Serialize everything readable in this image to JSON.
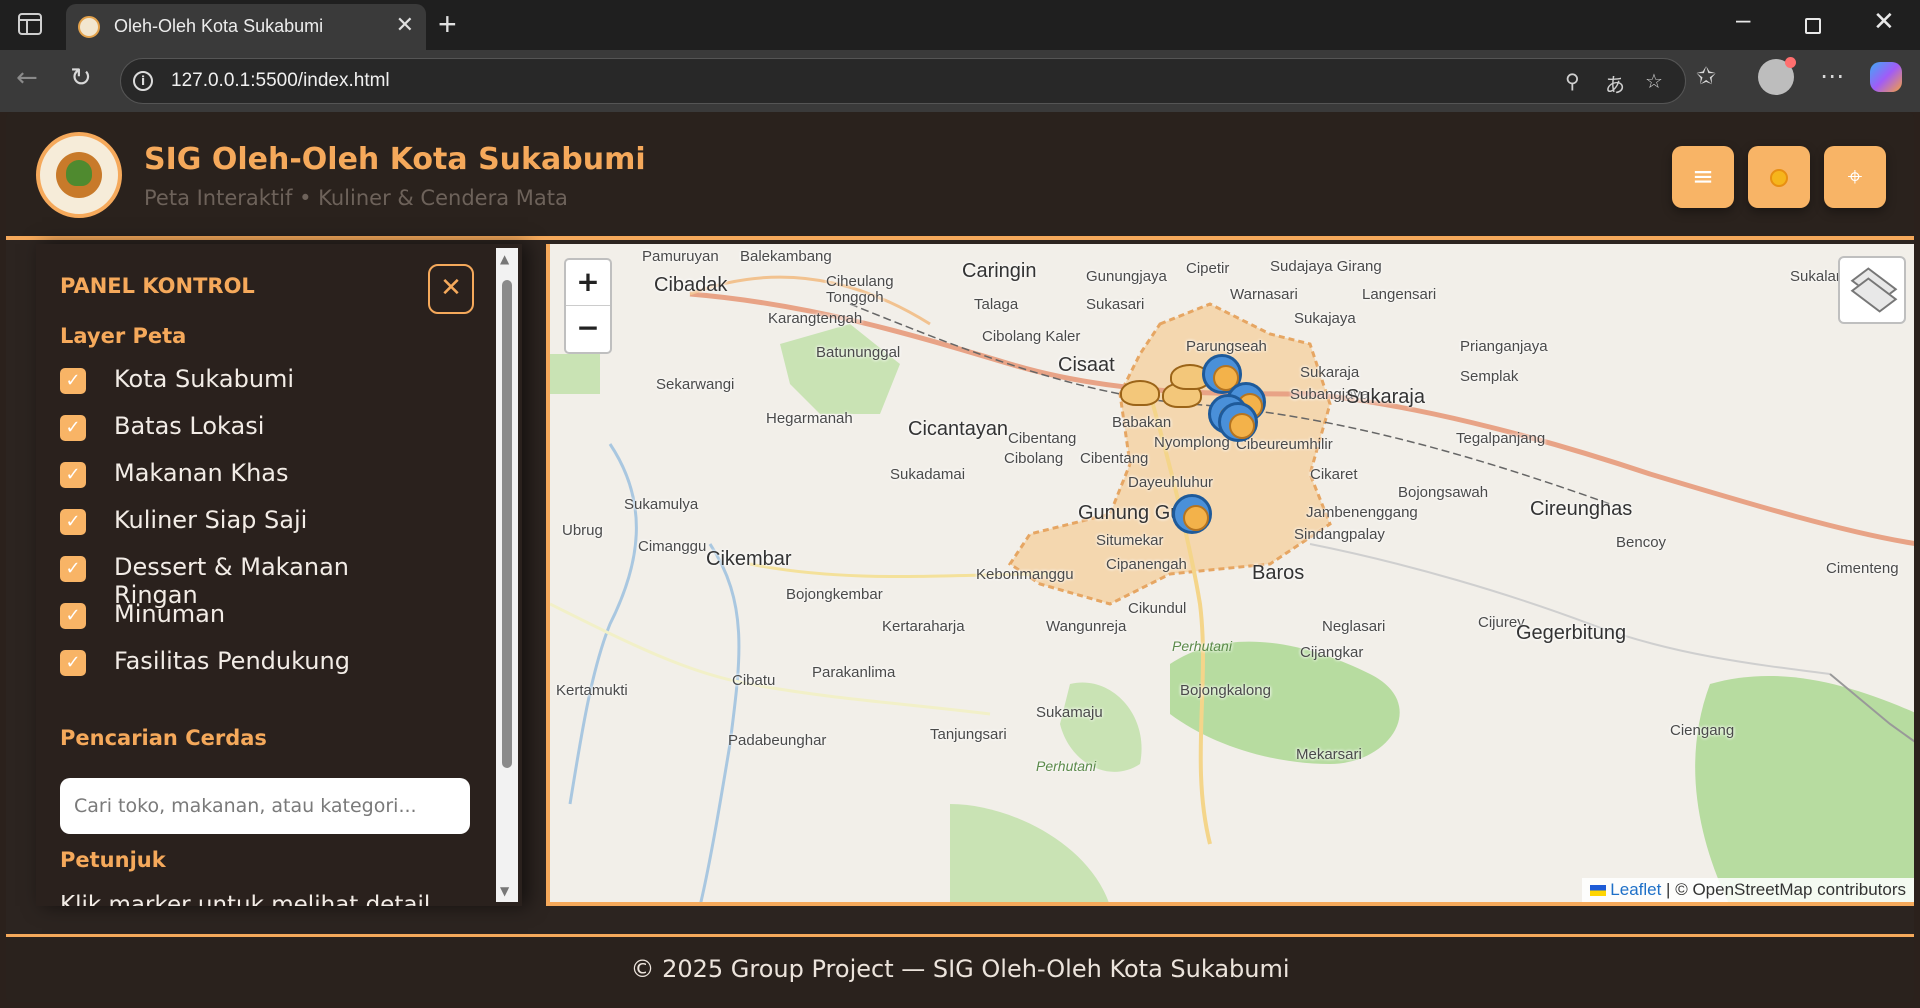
{
  "browser": {
    "tab_title": "Oleh-Oleh Kota Sukabumi",
    "url": "127.0.0.1:5500/index.html"
  },
  "header": {
    "title": "SIG Oleh-Oleh Kota Sukabumi",
    "subtitle": "Peta Interaktif • Kuliner & Cendera Mata",
    "menu_icon": "≡",
    "locate_icon": "⌖"
  },
  "panel": {
    "title": "PANEL KONTROL",
    "close_icon": "✕",
    "layers_title": "Layer Peta",
    "layers": [
      {
        "label": "Kota Sukabumi",
        "checked": true
      },
      {
        "label": "Batas Lokasi",
        "checked": true
      },
      {
        "label": "Makanan Khas",
        "checked": true
      },
      {
        "label": "Kuliner Siap Saji",
        "checked": true
      },
      {
        "label": "Dessert & Makanan Ringan",
        "checked": true
      },
      {
        "label": "Minuman",
        "checked": true
      },
      {
        "label": "Fasilitas Pendukung",
        "checked": true
      }
    ],
    "search_title": "Pencarian Cerdas",
    "search_placeholder": "Cari toko, makanan, atau kategori...",
    "hint_title": "Petunjuk",
    "hint_text": "Klik marker untuk melihat detail"
  },
  "map": {
    "zoom_in": "+",
    "zoom_out": "−",
    "places": [
      {
        "name": "Pamuruyan",
        "size": "small"
      },
      {
        "name": "Balekambang",
        "size": "small"
      },
      {
        "name": "Cibadak",
        "size": "big"
      },
      {
        "name": "Ciheulang Tonggoh",
        "size": "small"
      },
      {
        "name": "Caringin",
        "size": "big"
      },
      {
        "name": "Gunungjaya",
        "size": "small"
      },
      {
        "name": "Cipetir",
        "size": "small"
      },
      {
        "name": "Sudajaya Girang",
        "size": "small"
      },
      {
        "name": "Sukalarang",
        "size": "small"
      },
      {
        "name": "Karangtengah",
        "size": "small"
      },
      {
        "name": "Talaga",
        "size": "small"
      },
      {
        "name": "Sukasari",
        "size": "small"
      },
      {
        "name": "Warnasari",
        "size": "small"
      },
      {
        "name": "Langensari",
        "size": "small"
      },
      {
        "name": "Sukajaya",
        "size": "small"
      },
      {
        "name": "Cibolang Kaler",
        "size": "small"
      },
      {
        "name": "Batununggal",
        "size": "small"
      },
      {
        "name": "Parungseah",
        "size": "small"
      },
      {
        "name": "Prianganjaya",
        "size": "small"
      },
      {
        "name": "Cisaat",
        "size": "big"
      },
      {
        "name": "Sukaraja",
        "size": "small"
      },
      {
        "name": "Sekarwangi",
        "size": "small"
      },
      {
        "name": "Subangjaya",
        "size": "small"
      },
      {
        "name": "Sukaraja",
        "size": "big"
      },
      {
        "name": "Semplak",
        "size": "small"
      },
      {
        "name": "Hegarmanah",
        "size": "small"
      },
      {
        "name": "Babakan",
        "size": "small"
      },
      {
        "name": "Cicantayan",
        "size": "big"
      },
      {
        "name": "Cibentang",
        "size": "small"
      },
      {
        "name": "Nyomplong",
        "size": "small"
      },
      {
        "name": "Cibeureumhilir",
        "size": "small"
      },
      {
        "name": "Tegalpanjang",
        "size": "small"
      },
      {
        "name": "Cibolang",
        "size": "small"
      },
      {
        "name": "Cibentang",
        "size": "small"
      },
      {
        "name": "Sukadamai",
        "size": "small"
      },
      {
        "name": "Cikaret",
        "size": "small"
      },
      {
        "name": "Dayeuhluhur",
        "size": "small"
      },
      {
        "name": "Bojongsawah",
        "size": "small"
      },
      {
        "name": "Sukamulya",
        "size": "small"
      },
      {
        "name": "Gunung Guru",
        "size": "big"
      },
      {
        "name": "Jambenenggang",
        "size": "small"
      },
      {
        "name": "Cireunghas",
        "size": "big"
      },
      {
        "name": "Ubrug",
        "size": "small"
      },
      {
        "name": "Cimanggu",
        "size": "small"
      },
      {
        "name": "Situmekar",
        "size": "small"
      },
      {
        "name": "Sindangpalay",
        "size": "small"
      },
      {
        "name": "Bencoy",
        "size": "small"
      },
      {
        "name": "Cikembar",
        "size": "big"
      },
      {
        "name": "Kebonmanggu",
        "size": "small"
      },
      {
        "name": "Cipanengah",
        "size": "small"
      },
      {
        "name": "Baros",
        "size": "big"
      },
      {
        "name": "Cimenteng",
        "size": "small"
      },
      {
        "name": "Bojongkembar",
        "size": "small"
      },
      {
        "name": "Cikundul",
        "size": "small"
      },
      {
        "name": "Kertaraharja",
        "size": "small"
      },
      {
        "name": "Wangunreja",
        "size": "small"
      },
      {
        "name": "Cijurey",
        "size": "small"
      },
      {
        "name": "Neglasari",
        "size": "small"
      },
      {
        "name": "Gegerbitung",
        "size": "big"
      },
      {
        "name": "Perhutani",
        "size": "green"
      },
      {
        "name": "Cijangkar",
        "size": "small"
      },
      {
        "name": "Parakanlima",
        "size": "small"
      },
      {
        "name": "Cibatu",
        "size": "small"
      },
      {
        "name": "Kertamukti",
        "size": "small"
      },
      {
        "name": "Bojongkalong",
        "size": "small"
      },
      {
        "name": "Sukamaju",
        "size": "small"
      },
      {
        "name": "Tanjungsari",
        "size": "small"
      },
      {
        "name": "Padabeunghar",
        "size": "small"
      },
      {
        "name": "Ciengang",
        "size": "small"
      },
      {
        "name": "Perhutani",
        "size": "green"
      },
      {
        "name": "Mekarsari",
        "size": "small"
      }
    ],
    "attribution_link": "Leaflet",
    "attribution_rest": " | © OpenStreetMap contributors"
  },
  "footer": {
    "text": "© 2025 Group Project — SIG Oleh-Oleh Kota Sukabumi"
  },
  "colors": {
    "accent": "#f5a95b",
    "background": "#2c2420",
    "city_fill": "#f5d3a6"
  }
}
